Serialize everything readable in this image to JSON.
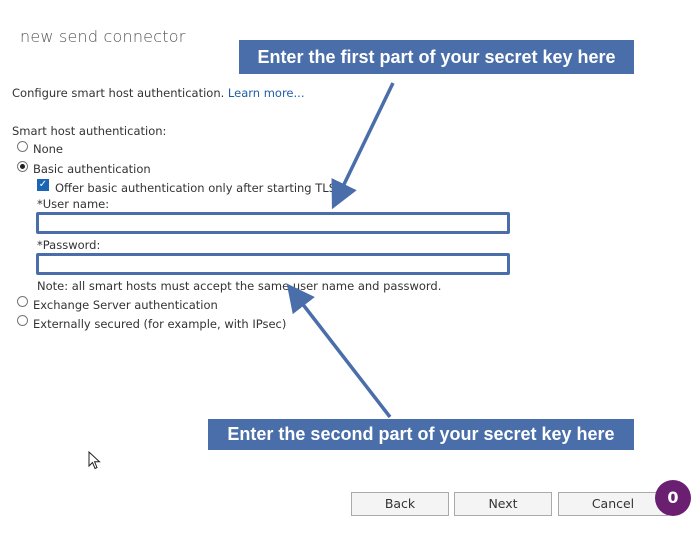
{
  "page": {
    "title": "new send connector"
  },
  "description": {
    "text": "Configure smart host authentication.",
    "link": "Learn more..."
  },
  "auth": {
    "heading": "Smart host authentication:",
    "options": [
      {
        "label": "None",
        "selected": false
      },
      {
        "label": "Basic authentication",
        "selected": true
      },
      {
        "label": "Exchange Server authentication",
        "selected": false
      },
      {
        "label": "Externally secured (for example, with IPsec)",
        "selected": false
      }
    ],
    "tls_checkbox": {
      "label": "Offer basic authentication only after starting TLS",
      "checked": true
    },
    "username": {
      "label": "*User name:",
      "value": ""
    },
    "password": {
      "label": "*Password:",
      "value": ""
    },
    "note": "Note: all smart hosts must accept the same user name and password."
  },
  "callouts": {
    "first": "Enter the first part of your secret key here",
    "second": "Enter the second part of your secret key here",
    "color": "#4a6ea9"
  },
  "buttons": {
    "back": "Back",
    "next": "Next",
    "cancel": "Cancel"
  },
  "badge": {
    "count": "0",
    "color": "#6b1f70"
  }
}
